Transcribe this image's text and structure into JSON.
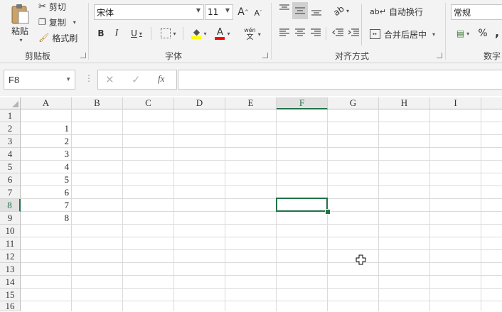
{
  "clipboard": {
    "paste_label": "粘贴",
    "cut_label": "剪切",
    "copy_label": "复制",
    "format_painter_label": "格式刷",
    "group_label": "剪贴板"
  },
  "font": {
    "font_name": "宋体",
    "font_size": "11",
    "grow_label": "A",
    "shrink_label": "A",
    "bold_label": "B",
    "italic_label": "I",
    "underline_label": "U",
    "font_color_label": "A",
    "phonetic_top": "wén",
    "phonetic_bottom": "文",
    "group_label": "字体",
    "fill_color": "#ffff00",
    "font_color": "#ff0000"
  },
  "alignment": {
    "wrap_text_label": "自动换行",
    "merge_center_label": "合并后居中",
    "group_label": "对齐方式"
  },
  "number": {
    "format_value": "常规",
    "percent_label": "%",
    "comma_label": ",",
    "group_label": "数字"
  },
  "formula_bar": {
    "name_box": "F8",
    "fx_label": "fx",
    "formula_value": ""
  },
  "sheet": {
    "columns": [
      "A",
      "B",
      "C",
      "D",
      "E",
      "F",
      "G",
      "H",
      "I"
    ],
    "rows": [
      "1",
      "2",
      "3",
      "4",
      "5",
      "6",
      "7",
      "8",
      "9",
      "10",
      "11",
      "12",
      "13",
      "14",
      "15",
      "16"
    ],
    "column_a_values": [
      "",
      "1",
      "2",
      "3",
      "4",
      "5",
      "6",
      "7",
      "8"
    ],
    "selected_cell": "F8",
    "accent_color": "#217346"
  },
  "cursor": {
    "icon": "cell-select-cross-cursor"
  }
}
